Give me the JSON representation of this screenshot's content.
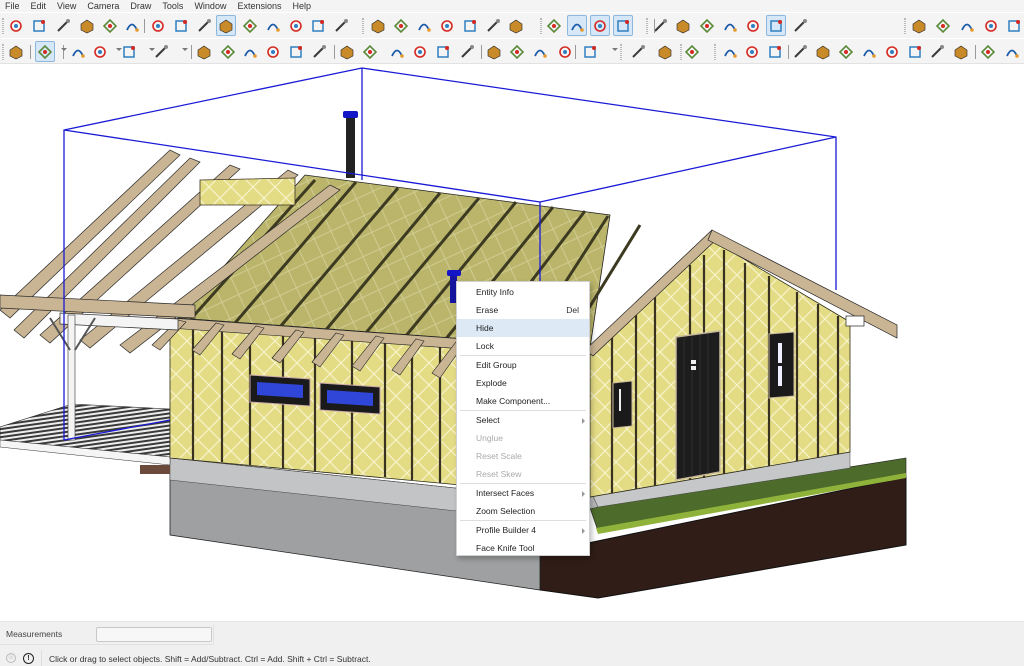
{
  "menubar": {
    "items": [
      "File",
      "Edit",
      "View",
      "Camera",
      "Draw",
      "Tools",
      "Window",
      "Extensions",
      "Help"
    ]
  },
  "toolbar": {
    "row1": [
      {
        "icon": "paint-bucket-icon"
      },
      {
        "icon": "arc-points-icon"
      },
      {
        "icon": "protractor-icon"
      },
      {
        "icon": "text-label-icon"
      },
      {
        "icon": "axes-icon"
      },
      {
        "icon": "3d-text-icon"
      },
      {
        "icon": "orbit-icon"
      },
      {
        "icon": "pan-icon"
      },
      {
        "icon": "zoom-icon"
      },
      {
        "icon": "zoom-window-icon",
        "active": true
      },
      {
        "icon": "zoom-extents-icon"
      },
      {
        "icon": "previous-view-icon"
      },
      {
        "icon": "position-camera-icon"
      },
      {
        "icon": "look-around-icon"
      },
      {
        "icon": "walk-icon"
      },
      {
        "icon": "iso-view-icon"
      },
      {
        "icon": "top-view-icon"
      },
      {
        "icon": "front-view-icon"
      },
      {
        "icon": "right-view-icon"
      },
      {
        "icon": "back-view-icon"
      },
      {
        "icon": "left-view-icon"
      },
      {
        "icon": "bottom-view-icon"
      },
      {
        "icon": "section-plane-icon"
      },
      {
        "icon": "display-section-planes-icon",
        "active": true
      },
      {
        "icon": "display-section-cuts-icon",
        "active": true
      },
      {
        "icon": "display-section-fill-icon",
        "active": true
      },
      {
        "icon": "xray-icon"
      },
      {
        "icon": "back-edges-icon"
      },
      {
        "icon": "wireframe-icon"
      },
      {
        "icon": "hidden-line-icon"
      },
      {
        "icon": "shaded-icon"
      },
      {
        "icon": "shaded-textures-icon",
        "active": true
      },
      {
        "icon": "monochrome-icon"
      },
      {
        "icon": "reload-icon"
      },
      {
        "icon": "reload-plus-icon"
      },
      {
        "icon": "plugin-icon"
      },
      {
        "icon": "export-icon"
      },
      {
        "icon": "document-icon"
      }
    ],
    "row2": [
      {
        "icon": "search-icon"
      },
      {
        "icon": "select-icon",
        "active": true
      },
      {
        "icon": "eraser-icon"
      },
      {
        "icon": "pencil-icon"
      },
      {
        "icon": "arc-icon"
      },
      {
        "icon": "rectangle-icon"
      },
      {
        "icon": "push-pull-icon"
      },
      {
        "icon": "follow-me-icon"
      },
      {
        "icon": "move-icon"
      },
      {
        "icon": "rotate-icon"
      },
      {
        "icon": "scale-icon"
      },
      {
        "icon": "mirror-icon"
      },
      {
        "icon": "paint-bucket-icon"
      },
      {
        "icon": "tape-measure-icon"
      },
      {
        "icon": "orbit-icon"
      },
      {
        "icon": "pan-icon"
      },
      {
        "icon": "zoom-icon"
      },
      {
        "icon": "zoom-extents-icon"
      },
      {
        "icon": "solid-tools-icon"
      },
      {
        "icon": "sandbox-icon"
      },
      {
        "icon": "layers-icon"
      },
      {
        "icon": "sandbox-settings-icon"
      },
      {
        "icon": "user-account-icon"
      },
      {
        "icon": "new-document-icon"
      },
      {
        "icon": "person-icon"
      },
      {
        "icon": "bounding-box-icon"
      },
      {
        "icon": "beam-icon"
      },
      {
        "icon": "dimension-icon"
      },
      {
        "icon": "profile-path-icon"
      },
      {
        "icon": "extrude-icon"
      },
      {
        "icon": "hierarchy-icon"
      },
      {
        "icon": "frame-icon"
      },
      {
        "icon": "pipe-icon"
      },
      {
        "icon": "face-icon"
      },
      {
        "icon": "wedge-icon"
      },
      {
        "icon": "knife-icon"
      },
      {
        "icon": "sweep-icon"
      },
      {
        "icon": "cut-face-icon"
      },
      {
        "icon": "cut-face-red-icon"
      }
    ]
  },
  "context_menu": {
    "items": [
      {
        "label": "Entity Info"
      },
      {
        "label": "Erase",
        "shortcut": "Del"
      },
      {
        "label": "Hide",
        "highlighted": true
      },
      {
        "label": "Lock"
      },
      {
        "separator": true
      },
      {
        "label": "Edit Group"
      },
      {
        "label": "Explode"
      },
      {
        "label": "Make Component..."
      },
      {
        "separator": true
      },
      {
        "label": "Select",
        "submenu": true
      },
      {
        "label": "Unglue",
        "disabled": true
      },
      {
        "label": "Reset Scale",
        "disabled": true
      },
      {
        "label": "Reset Skew",
        "disabled": true
      },
      {
        "separator": true
      },
      {
        "label": "Intersect Faces",
        "submenu": true
      },
      {
        "label": "Zoom Selection"
      },
      {
        "separator": true
      },
      {
        "label": "Profile Builder 4",
        "submenu": true
      },
      {
        "label": "Face Knife Tool"
      }
    ]
  },
  "statusbar": {
    "measurements_label": "Measurements",
    "measurements_value": "",
    "hint": "Click or drag to select objects. Shift = Add/Subtract. Ctrl = Add. Shift + Ctrl = Subtract.",
    "geo_icon": "geolocation-icon",
    "info_icon": "info-icon"
  },
  "scene": {
    "selection_color": "#1a1ad6",
    "insulation_color": "#e6de8a",
    "roof_color": "#b9b367",
    "lumber_color": "#c9b493",
    "ground_color": "#4d6b2a",
    "soil_color": "#301d17",
    "foundation_color": "#9ea0a2"
  }
}
